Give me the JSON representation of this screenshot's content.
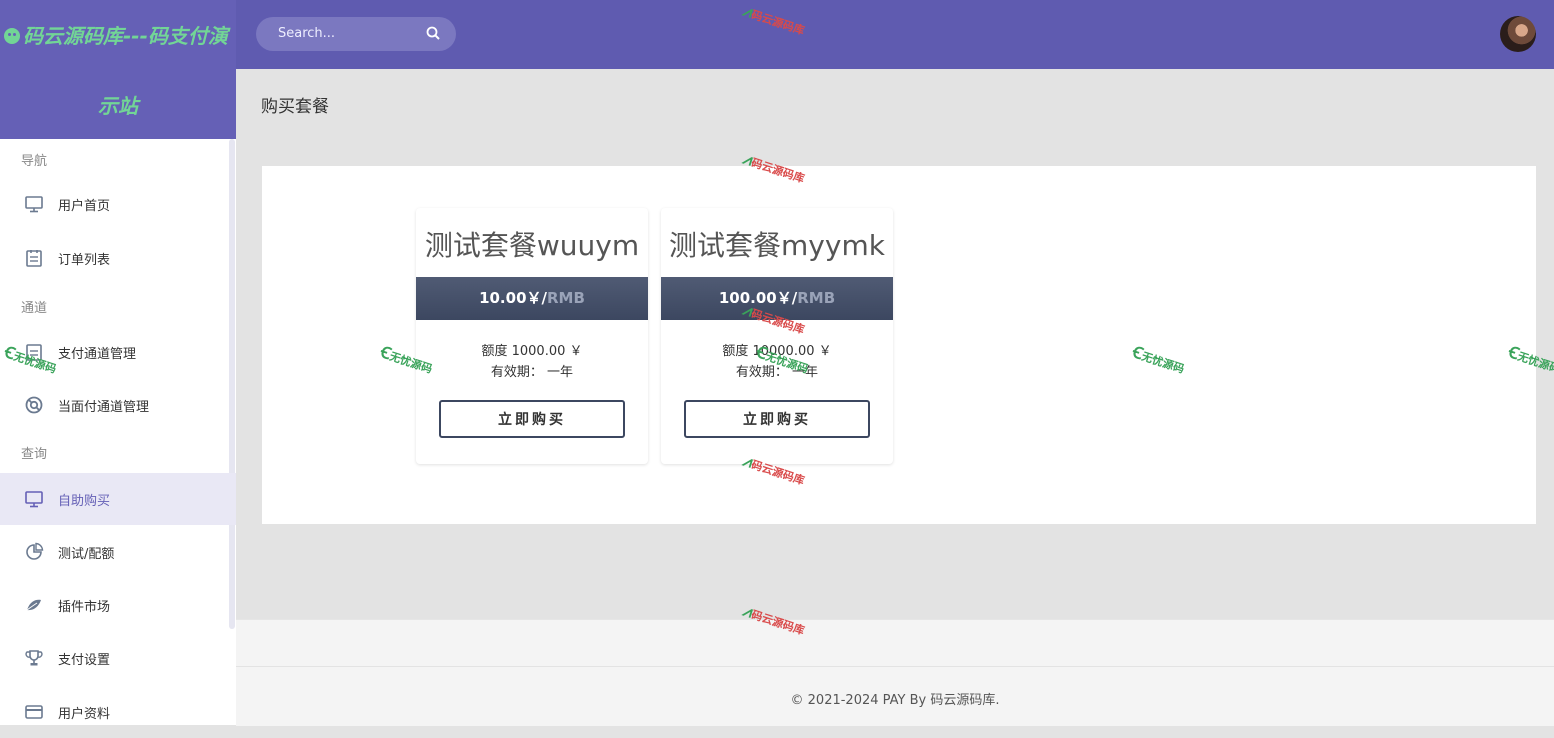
{
  "brand": {
    "line1": "码云源码库---码支付演",
    "line2": "示站"
  },
  "search": {
    "placeholder": "Search..."
  },
  "sidebar": {
    "sections": [
      "导航",
      "通道",
      "查询"
    ],
    "items": [
      {
        "label": "用户首页",
        "icon": "monitor-icon"
      },
      {
        "label": "订单列表",
        "icon": "clipboard-icon"
      },
      {
        "label": "支付通道管理",
        "icon": "clipboard-icon"
      },
      {
        "label": "当面付通道管理",
        "icon": "lifebuoy-icon"
      },
      {
        "label": "自助购买",
        "icon": "monitor-icon",
        "active": true
      },
      {
        "label": "测试/配额",
        "icon": "pie-chart-icon"
      },
      {
        "label": "插件市场",
        "icon": "leaf-icon"
      },
      {
        "label": "支付设置",
        "icon": "trophy-icon"
      },
      {
        "label": "用户资料",
        "icon": "card-icon"
      }
    ]
  },
  "page": {
    "title": "购买套餐"
  },
  "packages": [
    {
      "name": "测试套餐wuuym",
      "price": "10.00￥/",
      "unit": "RMB",
      "quota": "额度 1000.00 ￥",
      "validity": "有效期： 一年",
      "button": "立即购买"
    },
    {
      "name": "测试套餐myymk",
      "price": "100.00￥/",
      "unit": "RMB",
      "quota": "额度 10000.00 ￥",
      "validity": "有效期： 一年",
      "button": "立即购买"
    }
  ],
  "footer": {
    "text": "© 2021-2024 PAY By 码云源码库."
  },
  "watermarks": {
    "red": "码云源码库",
    "green": "无忧源码"
  },
  "colors": {
    "header": "#5f5bb0",
    "brand_text": "#72d596",
    "accent": "#6560b6",
    "price_bar": "#3c4760"
  }
}
